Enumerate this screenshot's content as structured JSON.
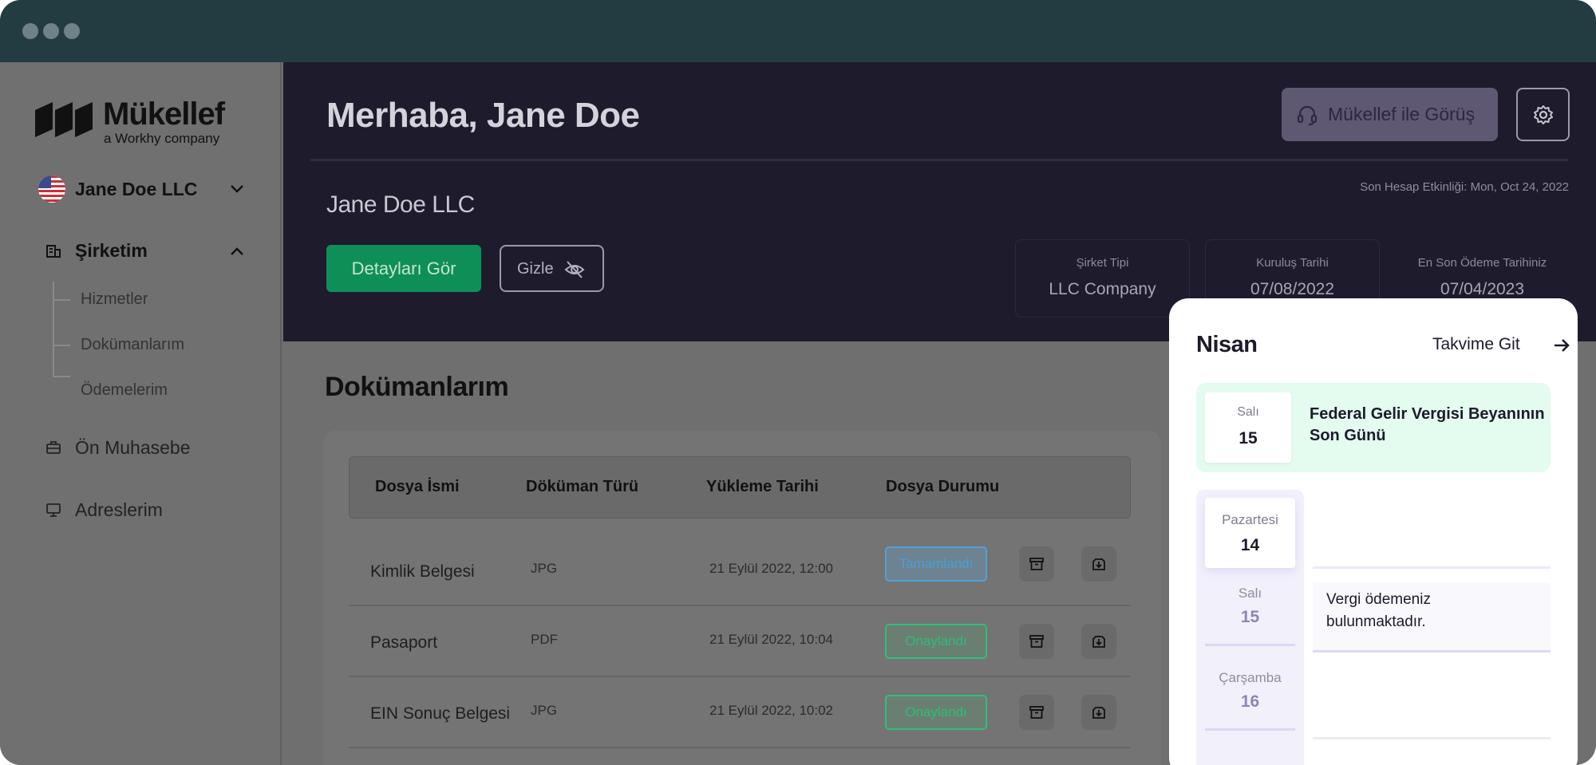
{
  "brand": {
    "name": "Mükellef",
    "tagline": "a Workhy company"
  },
  "sidebar": {
    "company_selector": "Jane Doe LLC",
    "nav": [
      {
        "label": "Şirketim",
        "icon": "building-icon",
        "expanded": true,
        "children": [
          "Hizmetler",
          "Dokümanlarım",
          "Ödemelerim"
        ]
      },
      {
        "label": "Ön Muhasebe",
        "icon": "briefcase-icon"
      },
      {
        "label": "Adreslerim",
        "icon": "monitor-icon"
      }
    ]
  },
  "header": {
    "greeting": "Merhaba, Jane Doe",
    "consult_button": "Mükellef ile Görüş",
    "last_activity": "Son Hesap Etkinliği: Mon, Oct 24, 2022",
    "company_name": "Jane Doe LLC",
    "details_button": "Detayları Gör",
    "hide_button": "Gizle",
    "info_cards": [
      {
        "label": "Şirket Tipi",
        "value": "LLC Company"
      },
      {
        "label": "Kuruluş Tarihi",
        "value": "07/08/2022"
      },
      {
        "label": "En Son Ödeme Tarihiniz",
        "value": "07/04/2023"
      }
    ]
  },
  "documents": {
    "title": "Dokümanlarım",
    "columns": [
      "Dosya İsmi",
      "Döküman Türü",
      "Yükleme Tarihi",
      "Dosya Durumu"
    ],
    "rows": [
      {
        "name": "Kimlik Belgesi",
        "type": "JPG",
        "date": "21 Eylül 2022, 12:00",
        "status": "Tamamlandı",
        "status_color": "#4a9fd6"
      },
      {
        "name": "Pasaport",
        "type": "PDF",
        "date": "21 Eylül 2022, 10:04",
        "status": "Onaylandı",
        "status_color": "#2bbf79"
      },
      {
        "name": "EIN Sonuç Belgesi",
        "type": "JPG",
        "date": "21 Eylül 2022, 10:02",
        "status": "Onaylandı",
        "status_color": "#2bbf79"
      }
    ]
  },
  "calendar": {
    "month": "Nisan",
    "link": "Takvime Git",
    "highlight": {
      "day_name": "Salı",
      "day": "15",
      "title": "Federal Gelir Vergisi Beyanının Son Günü"
    },
    "days": [
      {
        "day_name": "Pazartesi",
        "day": "14"
      },
      {
        "day_name": "Salı",
        "day": "15"
      },
      {
        "day_name": "Çarşamba",
        "day": "16"
      }
    ],
    "note": "Vergi  ödemeniz bulunmaktadır."
  },
  "colors": {
    "titlebar": "#223c42",
    "hero": "#1e1b2d",
    "primary_green": "#0e8f58",
    "highlight_bg": "#e4fbf0"
  }
}
